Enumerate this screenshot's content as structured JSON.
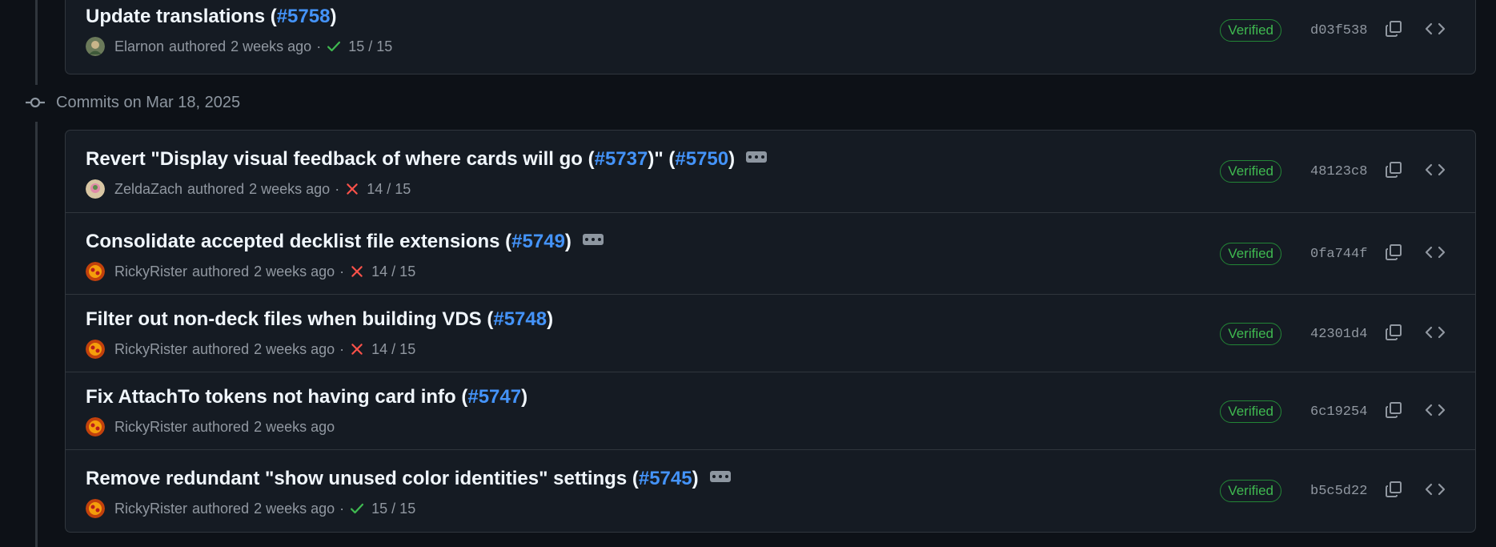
{
  "group": {
    "title": "Commits on Mar 18, 2025"
  },
  "labels": {
    "verified": "Verified",
    "authored": "authored",
    "dot": "·"
  },
  "colors": {
    "link": "#4493f8",
    "success": "#3fb950",
    "danger": "#f85149",
    "muted": "#9198a1"
  },
  "top_commit": {
    "title": "Update translations (",
    "pr": "#5758",
    "title_end": ")",
    "author": "Elarnon",
    "time": "2 weeks ago",
    "status": "success",
    "checks": "15 / 15",
    "sha": "d03f538",
    "has_ellipsis": false
  },
  "commits": [
    {
      "title": "Revert \"Display visual feedback of where cards will go (",
      "pr": "#5737",
      "title_mid": ")\" (",
      "pr2": "#5750",
      "title_end": ")",
      "author": "ZeldaZach",
      "time": "2 weeks ago",
      "status": "fail",
      "checks": "14 / 15",
      "sha": "48123c8",
      "has_ellipsis": true
    },
    {
      "title": "Consolidate accepted decklist file extensions (",
      "pr": "#5749",
      "title_end": ")",
      "author": "RickyRister",
      "time": "2 weeks ago",
      "status": "fail",
      "checks": "14 / 15",
      "sha": "0fa744f",
      "has_ellipsis": true
    },
    {
      "title": "Filter out non-deck files when building VDS (",
      "pr": "#5748",
      "title_end": ")",
      "author": "RickyRister",
      "time": "2 weeks ago",
      "status": "fail",
      "checks": "14 / 15",
      "sha": "42301d4",
      "has_ellipsis": false
    },
    {
      "title": "Fix AttachTo tokens not having card info (",
      "pr": "#5747",
      "title_end": ")",
      "author": "RickyRister",
      "time": "2 weeks ago",
      "status": "none",
      "checks": "",
      "sha": "6c19254",
      "has_ellipsis": false
    },
    {
      "title": "Remove redundant \"show unused color identities\" settings (",
      "pr": "#5745",
      "title_end": ")",
      "author": "RickyRister",
      "time": "2 weeks ago",
      "status": "success",
      "checks": "15 / 15",
      "sha": "b5c5d22",
      "has_ellipsis": true
    }
  ]
}
